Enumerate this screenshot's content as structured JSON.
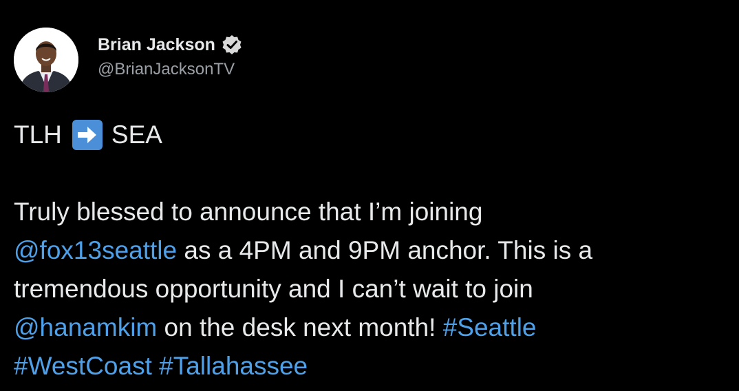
{
  "user": {
    "display_name": "Brian Jackson",
    "handle": "@BrianJacksonTV",
    "verified": true,
    "avatar_icon": "profile-photo"
  },
  "tweet": {
    "route": {
      "from": "TLH",
      "arrow_icon": "right-arrow-emoji",
      "to": "SEA"
    },
    "line1": "Truly blessed to announce that I’m joining",
    "mention1": "@fox13seattle",
    "line2_rest": " as a 4PM and 9PM anchor. This is a",
    "line3": "tremendous opportunity and I can’t wait to join",
    "mention2": "@hanamkim",
    "line4_rest": " on the desk next month! ",
    "hashtag1": "#Seattle",
    "hashtag2": "#WestCoast",
    "hashtag3": "#Tallahassee",
    "space": " "
  },
  "colors": {
    "background": "#000000",
    "text": "#e7e9ea",
    "secondary": "#9aa0a5",
    "link": "#4ea0e8"
  }
}
